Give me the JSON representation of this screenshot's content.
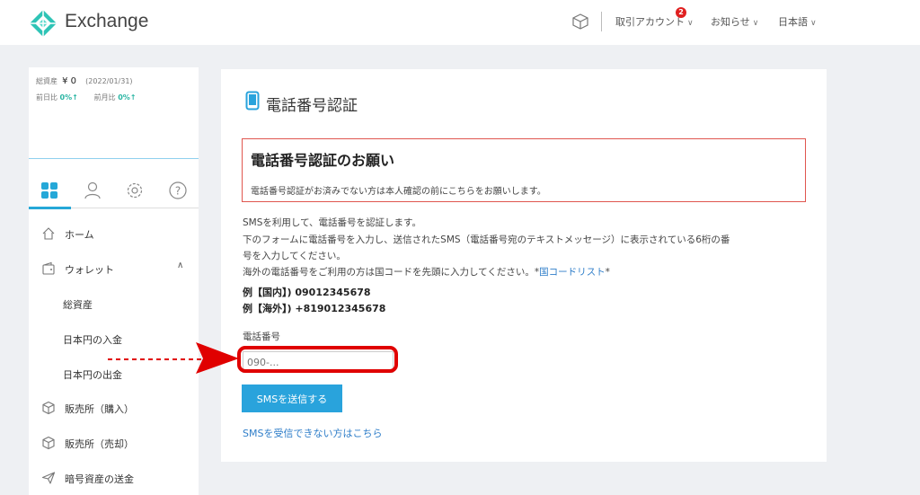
{
  "header": {
    "brand": "Exchange",
    "trade_account": "取引アカウント",
    "trade_badge": "2",
    "news": "お知らせ",
    "language": "日本語"
  },
  "sidebar": {
    "total_assets_label": "総資産",
    "total_assets_value": "¥ 0",
    "date": "(2022/01/31)",
    "day_change_label": "前日比",
    "day_change_value": "0%↑",
    "month_change_label": "前月比",
    "month_change_value": "0%↑",
    "nav": [
      {
        "label": "ホーム"
      },
      {
        "label": "ウォレット"
      },
      {
        "label": "総資産"
      },
      {
        "label": "日本円の入金"
      },
      {
        "label": "日本円の出金"
      },
      {
        "label": "販売所（購入）"
      },
      {
        "label": "販売所（売却）"
      },
      {
        "label": "暗号資産の送金"
      }
    ]
  },
  "main": {
    "title": "電話番号認証",
    "notice_title": "電話番号認証のお願い",
    "notice_text": "電話番号認証がお済みでない方は本人確認の前にこちらをお願いします。",
    "desc_1": "SMSを利用して、電話番号を認証します。",
    "desc_2": "下のフォームに電話番号を入力し、送信されたSMS（電話番号宛のテキストメッセージ）に表示されている6桁の番",
    "desc_3": "号を入力してください。",
    "desc_4_prefix": "海外の電話番号をご利用の方は国コードを先頭に入力してください。*",
    "country_code_link": "国コードリスト",
    "desc_4_suffix": "*",
    "example_domestic": "例【国内】) 09012345678",
    "example_overseas": "例【海外】) +819012345678",
    "phone_label": "電話番号",
    "phone_placeholder": "090-...",
    "phone_value": "",
    "send_button": "SMSを送信する",
    "help_link": "SMSを受信できない方はこちら"
  },
  "colors": {
    "accent": "#29a3dc",
    "notice_border": "#e0564f",
    "highlight": "#e00000",
    "positive": "#2ab5a3",
    "brand_teal": "#2ec4b6"
  }
}
